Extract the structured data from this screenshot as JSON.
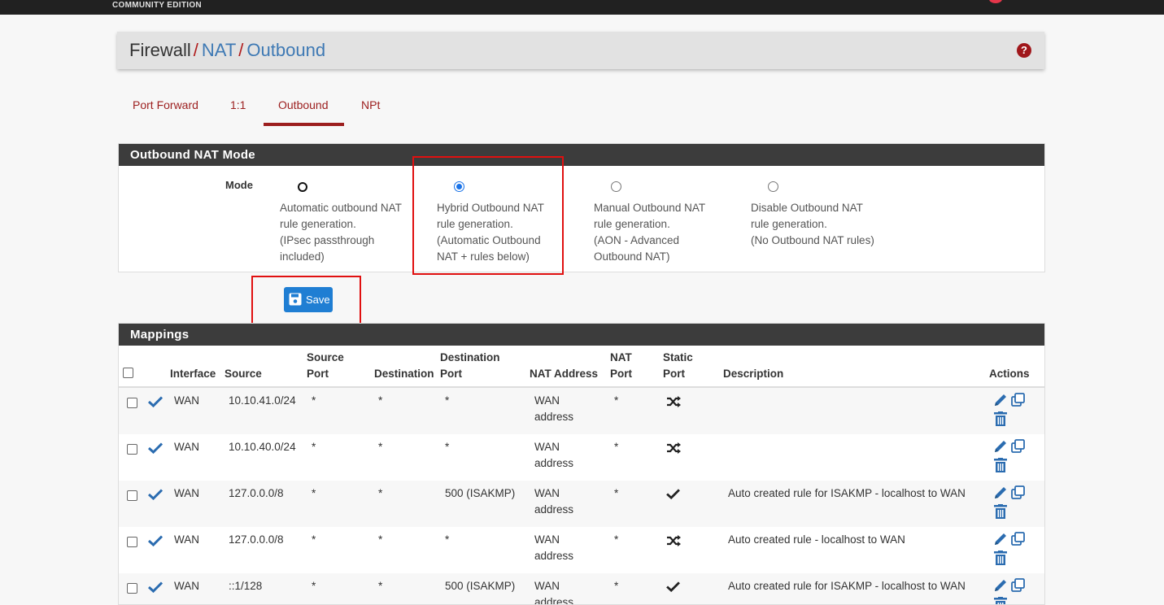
{
  "header": {
    "edition_label": "COMMUNITY EDITION"
  },
  "breadcrumb": {
    "first": "Firewall",
    "sep": "/",
    "second": "NAT",
    "third": "Outbound"
  },
  "tabs": [
    {
      "label": "Port Forward"
    },
    {
      "label": "1:1"
    },
    {
      "label": "Outbound",
      "active": true
    },
    {
      "label": "NPt"
    }
  ],
  "mode_panel": {
    "title": "Outbound NAT Mode",
    "label": "Mode",
    "options": [
      {
        "text": "Automatic outbound NAT\nrule generation.\n(IPsec passthrough\nincluded)",
        "selected": false
      },
      {
        "text": "Hybrid Outbound NAT\nrule generation.\n(Automatic Outbound\nNAT + rules below)",
        "selected": true
      },
      {
        "text": "Manual Outbound NAT\nrule generation.\n(AON - Advanced\nOutbound NAT)",
        "selected": false
      },
      {
        "text": "Disable Outbound NAT\nrule generation.\n(No Outbound NAT rules)",
        "selected": false
      }
    ]
  },
  "save_button": {
    "label": "Save"
  },
  "mappings": {
    "title": "Mappings",
    "columns": [
      "Interface",
      "Source",
      "Source\nPort",
      "Destination",
      "Destination\nPort",
      "NAT Address",
      "NAT\nPort",
      "Static\nPort",
      "Description",
      "Actions"
    ],
    "rows": [
      {
        "interface": "WAN",
        "source": "10.10.41.0/24",
        "source_port": "*",
        "destination": "*",
        "destination_port": "*",
        "nat_address": "WAN\naddress",
        "nat_port": "*",
        "static_port_icon": "shuffle-icon",
        "description": ""
      },
      {
        "interface": "WAN",
        "source": "10.10.40.0/24",
        "source_port": "*",
        "destination": "*",
        "destination_port": "*",
        "nat_address": "WAN\naddress",
        "nat_port": "*",
        "static_port_icon": "shuffle-icon",
        "description": ""
      },
      {
        "interface": "WAN",
        "source": "127.0.0.0/8",
        "source_port": "*",
        "destination": "*",
        "destination_port": "500 (ISAKMP)",
        "nat_address": "WAN\naddress",
        "nat_port": "*",
        "static_port_icon": "check-icon",
        "description": "Auto created rule for ISAKMP - localhost to WAN"
      },
      {
        "interface": "WAN",
        "source": "127.0.0.0/8",
        "source_port": "*",
        "destination": "*",
        "destination_port": "*",
        "nat_address": "WAN\naddress",
        "nat_port": "*",
        "static_port_icon": "shuffle-icon",
        "description": "Auto created rule - localhost to WAN"
      },
      {
        "interface": "WAN",
        "source": "::1/128",
        "source_port": "*",
        "destination": "*",
        "destination_port": "500 (ISAKMP)",
        "nat_address": "WAN\naddress",
        "nat_port": "*",
        "static_port_icon": "check-icon",
        "description": "Auto created rule for ISAKMP - localhost to WAN"
      }
    ]
  },
  "colors": {
    "accent": "#9c1e1e",
    "link": "#3e79b4",
    "panel_header": "#3c3c3c",
    "button": "#1f7ed3",
    "highlight": "#e01010"
  }
}
